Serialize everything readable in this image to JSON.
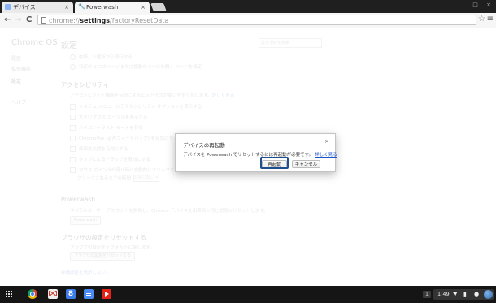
{
  "browser": {
    "tabs": [
      {
        "title": "デバイス",
        "close": "×"
      },
      {
        "title": "Powerwash",
        "close": "×"
      }
    ],
    "window_controls": {
      "minimize": "□",
      "close": "×"
    },
    "nav": {
      "back": "←",
      "forward": "→",
      "reload": "C"
    },
    "url": {
      "prefix": "chrome://",
      "bold": "settings",
      "suffix": "/factoryResetData"
    },
    "star": "☆",
    "menu": "≡"
  },
  "settings": {
    "brand": "Chrome OS",
    "title": "設定",
    "search_placeholder": "設定項目を検索",
    "sidebar": [
      "履歴",
      "拡張機能",
      "設定",
      "ヘルプ"
    ],
    "startup_options": [
      "中断した箇所から続行する",
      "特定の 1 つのページまたは複数のページを開く ページを設定"
    ],
    "accessibility": {
      "title": "アクセシビリティ",
      "description": "アクセシビリティ機能を有効にするとデバイスが使いやすくなります。",
      "description_link": "詳しく見る",
      "options": [
        "システム メニューにアクセシビリティ オプションを表示する",
        "大きいマウス カーソルを表示する",
        "ハイコントラスト モードを有効",
        "ChromeVox (音声フィードバック) を有効にする",
        "画面拡大鏡を有効にする",
        "タップによるドラッグを有効にする",
        "マウス ポインタの停止時に自動的にクリックする"
      ],
      "delay_label": "クリックされるまでの時間",
      "delay_value": "非常に短い ▾"
    },
    "powerwash": {
      "title": "Powerwash",
      "description": "すべてのユーザー アカウントを削除し、Chrome デバイスを出荷時と同じ状態にリセットします。",
      "button": "Powerwash"
    },
    "reset": {
      "title": "ブラウザの設定をリセットする",
      "description": "ブラウザの設定をデフォルトに戻します。",
      "button": "ブラウザの設定をリセットする"
    },
    "hide_advanced": "詳細設定を表示しない..."
  },
  "dialog": {
    "title": "デバイスの再起動",
    "close": "×",
    "message": "デバイスを Powerwash でリセットするには再起動が必要です。",
    "learn_more": "詳しく見る",
    "restart_button": "再起動",
    "cancel_button": "キャンセル"
  },
  "shelf": {
    "search_app_label": "8",
    "notification_count": "1",
    "time": "1:49"
  }
}
